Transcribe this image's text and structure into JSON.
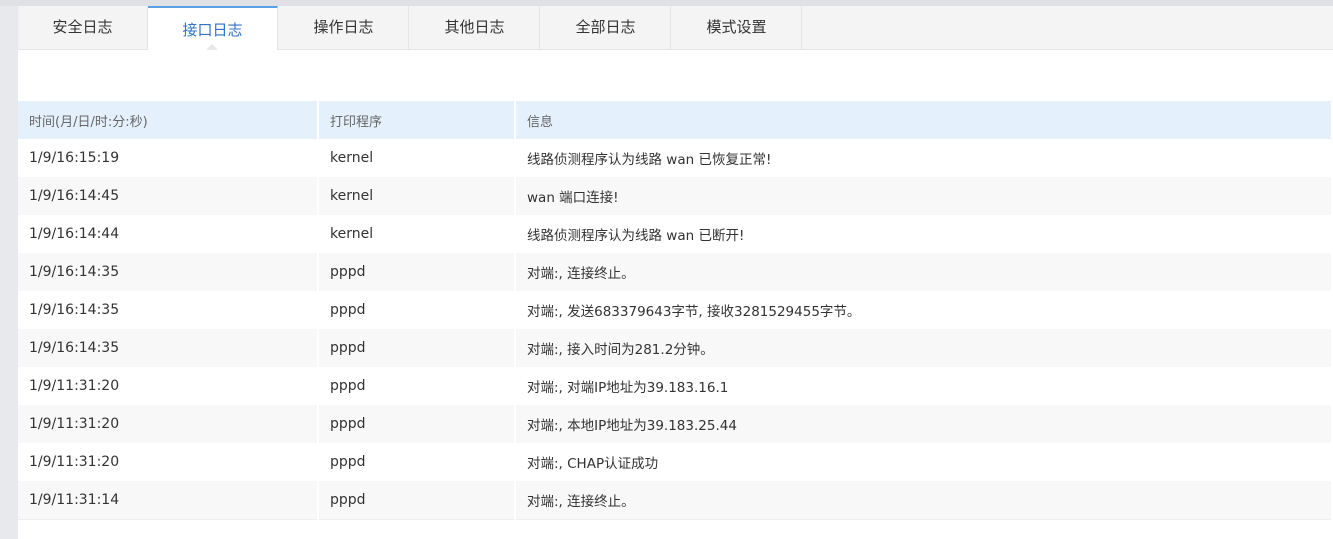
{
  "tabs": [
    {
      "label": "安全日志",
      "active": false
    },
    {
      "label": "接口日志",
      "active": true
    },
    {
      "label": "操作日志",
      "active": false
    },
    {
      "label": "其他日志",
      "active": false
    },
    {
      "label": "全部日志",
      "active": false
    },
    {
      "label": "模式设置",
      "active": false
    }
  ],
  "table": {
    "headers": {
      "time": "时间(月/日/时:分:秒)",
      "program": "打印程序",
      "message": "信息"
    },
    "rows": [
      {
        "time": "1/9/16:15:19",
        "program": "kernel",
        "message": "线路侦测程序认为线路 wan 已恢复正常!"
      },
      {
        "time": "1/9/16:14:45",
        "program": "kernel",
        "message": "wan 端口连接!"
      },
      {
        "time": "1/9/16:14:44",
        "program": "kernel",
        "message": "线路侦测程序认为线路 wan 已断开!"
      },
      {
        "time": "1/9/16:14:35",
        "program": "pppd",
        "message": "对端:, 连接终止。"
      },
      {
        "time": "1/9/16:14:35",
        "program": "pppd",
        "message": "对端:, 发送683379643字节, 接收3281529455字节。"
      },
      {
        "time": "1/9/16:14:35",
        "program": "pppd",
        "message": "对端:, 接入时间为281.2分钟。"
      },
      {
        "time": "1/9/11:31:20",
        "program": "pppd",
        "message": "对端:, 对端IP地址为39.183.16.1"
      },
      {
        "time": "1/9/11:31:20",
        "program": "pppd",
        "message": "对端:, 本地IP地址为39.183.25.44"
      },
      {
        "time": "1/9/11:31:20",
        "program": "pppd",
        "message": "对端:, CHAP认证成功"
      },
      {
        "time": "1/9/11:31:14",
        "program": "pppd",
        "message": "对端:, 连接终止。"
      }
    ]
  },
  "colors": {
    "active_tab_text": "#2f73c9",
    "active_tab_border": "#5aa0e6",
    "header_bg": "#e4f0fb",
    "odd_row_bg": "#f8f8f9"
  }
}
